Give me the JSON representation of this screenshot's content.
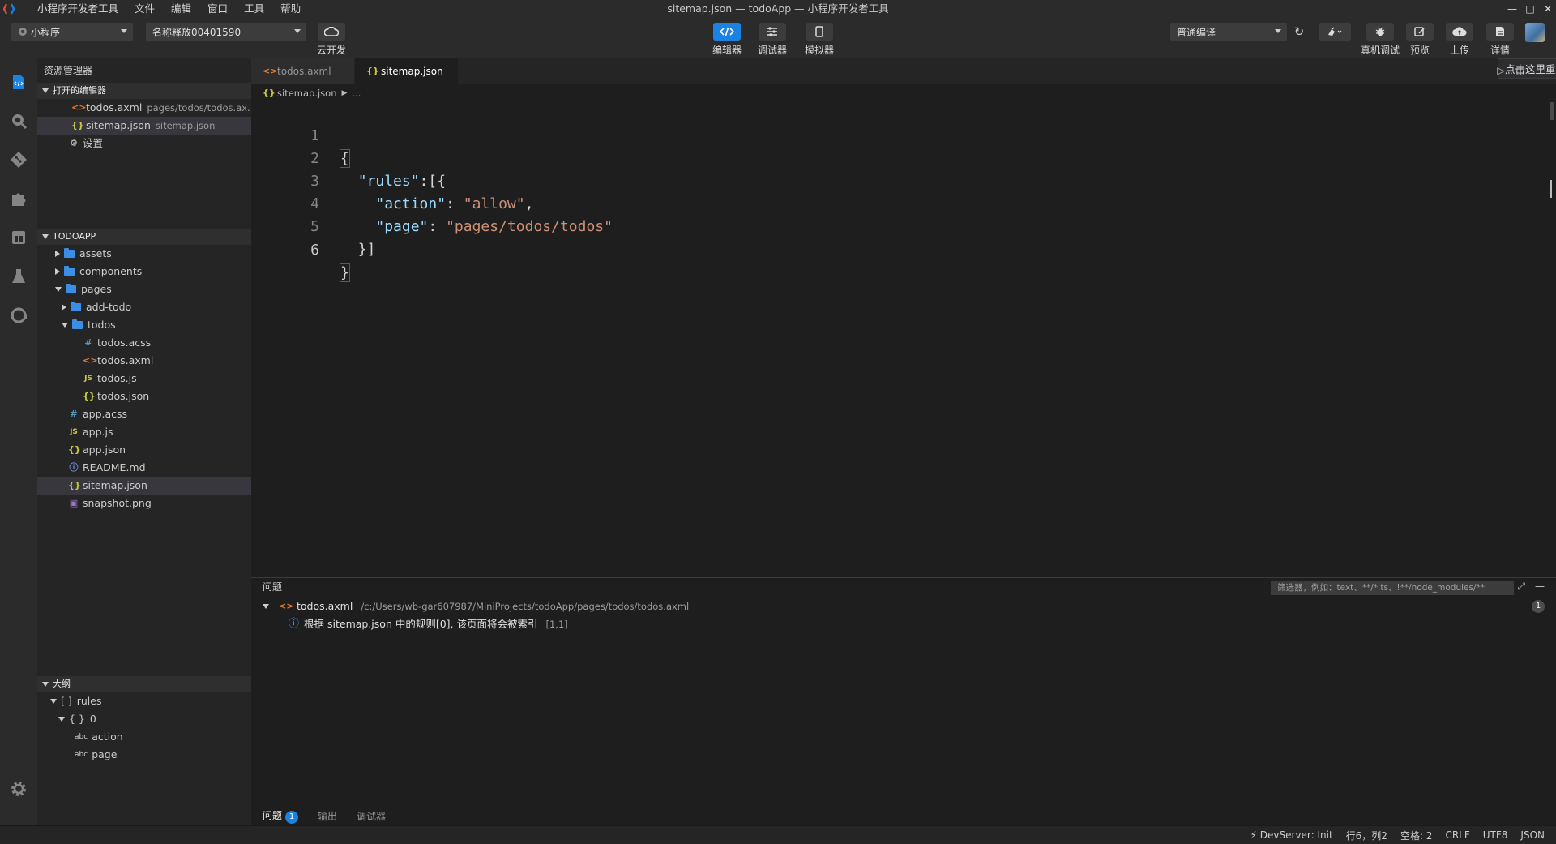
{
  "window": {
    "title": "sitemap.json — todoApp — 小程序开发者工具",
    "menu": [
      "小程序开发者工具",
      "文件",
      "编辑",
      "窗口",
      "工具",
      "帮助"
    ]
  },
  "toolbar": {
    "mode": "小程序",
    "project": "名称释放00401590",
    "cloud_dev": "云开发",
    "editor": "编辑器",
    "debugger": "调试器",
    "simulator": "模拟器",
    "compile_mode": "普通编译",
    "real_device": "真机调试",
    "preview": "预览",
    "upload": "上传",
    "details": "详情",
    "recompile_tip": "点击这里重新编译",
    "recompile_close": "x"
  },
  "sidebar": {
    "title": "资源管理器",
    "open_editors": {
      "header": "打开的编辑器",
      "items": [
        {
          "name": "todos.axml",
          "desc": "pages/todos/todos.ax...",
          "icon": "axml-icon"
        },
        {
          "name": "sitemap.json",
          "desc": "sitemap.json",
          "icon": "json-icon"
        },
        {
          "name": "设置",
          "desc": "",
          "icon": "gear-icon"
        }
      ]
    },
    "project": {
      "header": "TODOAPP",
      "tree": [
        {
          "name": "assets",
          "type": "folder"
        },
        {
          "name": "components",
          "type": "folder"
        },
        {
          "name": "pages",
          "type": "folder-open"
        },
        {
          "name": "add-todo",
          "type": "folder"
        },
        {
          "name": "todos",
          "type": "folder-open"
        },
        {
          "name": "todos.acss",
          "type": "css",
          "glyph": "#"
        },
        {
          "name": "todos.axml",
          "type": "xml",
          "glyph": "<>"
        },
        {
          "name": "todos.js",
          "type": "js",
          "glyph": "JS"
        },
        {
          "name": "todos.json",
          "type": "json",
          "glyph": "{}"
        },
        {
          "name": "app.acss",
          "type": "css",
          "glyph": "#"
        },
        {
          "name": "app.js",
          "type": "js",
          "glyph": "JS"
        },
        {
          "name": "app.json",
          "type": "json",
          "glyph": "{}"
        },
        {
          "name": "README.md",
          "type": "info",
          "glyph": "i"
        },
        {
          "name": "sitemap.json",
          "type": "json",
          "glyph": "{}"
        },
        {
          "name": "snapshot.png",
          "type": "img",
          "glyph": "▣"
        }
      ]
    },
    "outline": {
      "header": "大纲",
      "items": [
        {
          "glyph": "[ ]",
          "name": "rules"
        },
        {
          "glyph": "{ }",
          "name": "0"
        },
        {
          "glyph": "abc",
          "name": "action"
        },
        {
          "glyph": "abc",
          "name": "page"
        }
      ]
    }
  },
  "editor": {
    "tabs": [
      {
        "label": "todos.axml",
        "glyph": "<>",
        "active": false
      },
      {
        "label": "sitemap.json",
        "glyph": "{}",
        "active": true
      }
    ],
    "breadcrumb": {
      "glyph": "{}",
      "file": "sitemap.json",
      "rest": "..."
    },
    "lines": [
      "1",
      "2",
      "3",
      "4",
      "5",
      "6"
    ],
    "code": {
      "l1": "{",
      "l2_key": "\"rules\"",
      "l2_rest": ":[{",
      "l3_key": "\"action\"",
      "l3_colon": ": ",
      "l3_val": "\"allow\"",
      "l3_comma": ",",
      "l4_key": "\"page\"",
      "l4_colon": ": ",
      "l4_val": "\"pages/todos/todos\"",
      "l5": "}]",
      "l6": "}"
    }
  },
  "panel": {
    "title": "问题",
    "filter_placeholder": "筛选器，例如：text、**/*.ts、!**/node_modules/**",
    "problem_file": "todos.axml",
    "problem_path": "/c:/Users/wb-gar607987/MiniProjects/todoApp/pages/todos/todos.axml",
    "problem_count": "1",
    "problem_message": "根据 sitemap.json 中的规则[0], 该页面将会被索引",
    "problem_location": "[1,1]",
    "tabs": [
      "问题",
      "输出",
      "调试器"
    ],
    "tab_badge": "1"
  },
  "status": {
    "devserver": "DevServer: Init",
    "position": "行6，列2",
    "spaces": "空格: 2",
    "eol": "CRLF",
    "encoding": "UTF8",
    "language": "JSON"
  },
  "colors": {
    "accent": "#1a82e2",
    "json_key": "#9cdcfe",
    "json_string": "#ce9178",
    "axml_icon": "#e37933",
    "json_icon": "#cbcb41",
    "folder": "#3a8ee6"
  }
}
